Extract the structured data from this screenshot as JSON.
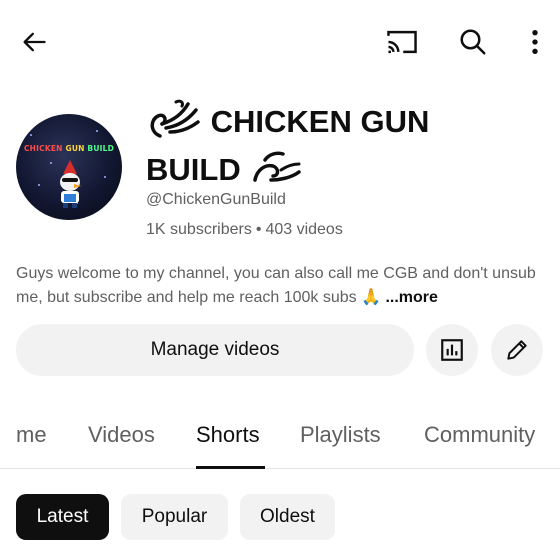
{
  "header": {
    "back_icon": "arrow-left-icon",
    "cast_icon": "cast-icon",
    "search_icon": "search-icon",
    "more_icon": "more-vertical-icon"
  },
  "channel": {
    "avatar_text": [
      "CHICKEN",
      "GUN",
      "BUILD"
    ],
    "name_line1": "CHICKEN GUN",
    "name_line2": "BUILD",
    "handle": "@ChickenGunBuild",
    "subscribers": "1K subscribers",
    "separator": "•",
    "videos": "403 videos",
    "description": "Guys welcome to my channel, you can also call me CGB and don't unsub me, but subscribe and help me reach 100k subs 🙏",
    "more_label": "...more"
  },
  "actions": {
    "manage_label": "Manage videos",
    "analytics_icon": "analytics-icon",
    "edit_icon": "pencil-icon"
  },
  "tabs": [
    {
      "label": "me"
    },
    {
      "label": "Videos"
    },
    {
      "label": "Shorts",
      "active": true
    },
    {
      "label": "Playlists"
    },
    {
      "label": "Community"
    }
  ],
  "chips": [
    {
      "label": "Latest",
      "selected": true
    },
    {
      "label": "Popular"
    },
    {
      "label": "Oldest"
    }
  ]
}
